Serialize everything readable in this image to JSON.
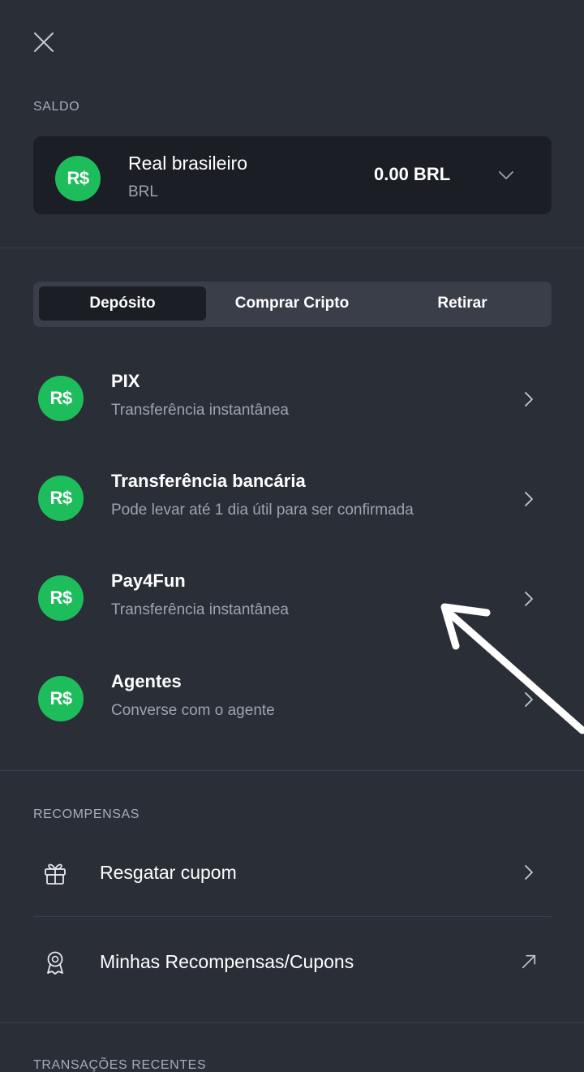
{
  "header": {
    "close_icon": "close-icon"
  },
  "balance": {
    "section_label": "SALDO",
    "currency_symbol": "R$",
    "currency_name": "Real brasileiro",
    "currency_code": "BRL",
    "amount": "0.00 BRL"
  },
  "tabs": [
    {
      "label": "Depósito",
      "active": true
    },
    {
      "label": "Comprar Cripto",
      "active": false
    },
    {
      "label": "Retirar",
      "active": false
    }
  ],
  "methods": [
    {
      "symbol": "R$",
      "title": "PIX",
      "subtitle": "Transferência instantânea"
    },
    {
      "symbol": "R$",
      "title": "Transferência bancária",
      "subtitle": "Pode levar até 1 dia útil para ser confirmada"
    },
    {
      "symbol": "R$",
      "title": "Pay4Fun",
      "subtitle": "Transferência instantânea"
    },
    {
      "symbol": "R$",
      "title": "Agentes",
      "subtitle": "Converse com o agente"
    }
  ],
  "rewards": {
    "section_label": "RECOMPENSAS",
    "items": [
      {
        "label": "Resgatar cupom",
        "icon": "gift-icon",
        "action_icon": "chevron-right-icon"
      },
      {
        "label": "Minhas Recompensas/Cupons",
        "icon": "award-icon",
        "action_icon": "external-arrow-icon"
      }
    ]
  },
  "transactions": {
    "section_label": "TRANSAÇÕES RECENTES"
  },
  "colors": {
    "background": "#2a2e36",
    "card": "#1b1e24",
    "tab_bar": "#393e48",
    "coin_green": "#1ebd5b",
    "muted_text": "#9ea3ae"
  }
}
